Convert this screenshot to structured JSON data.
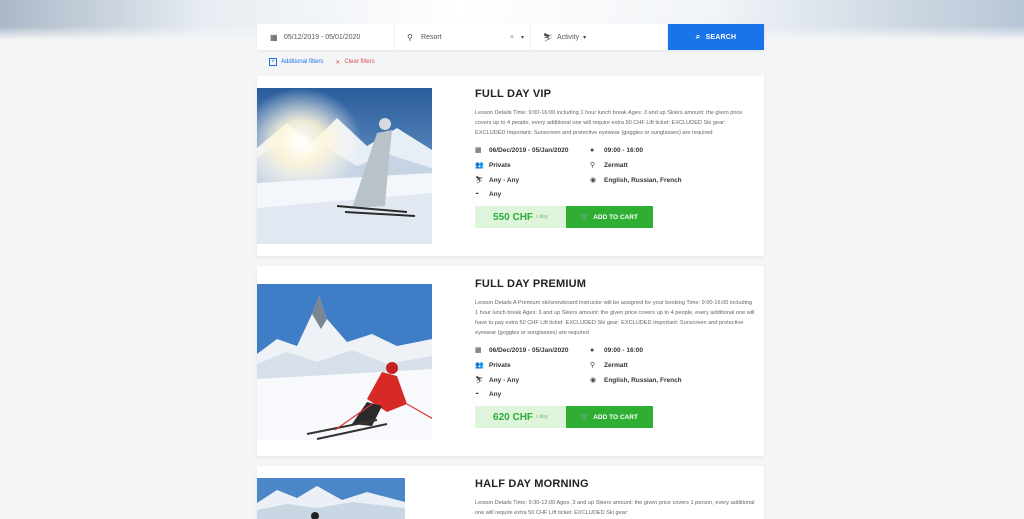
{
  "search": {
    "date_range": "05/12/2019 - 05/01/2020",
    "resort_placeholder": "Resort",
    "resort_clear": "×",
    "activity_label": "Activity",
    "search_label": "SEARCH",
    "icons": {
      "date": "calendar-icon",
      "resort": "map-pin-icon",
      "activity": "skier-icon",
      "search": "search-icon"
    }
  },
  "filters": {
    "additional_label": "Additional filters",
    "clear_label": "Clear filters"
  },
  "lessons": [
    {
      "title": "FULL DAY VIP",
      "description": "Lesson Details Time: 9:00-16:00 including 1 hour lunch break Ages: 3 and up Skiers amount: the given price covers up to 4 people, every additional one will require extra 50 CHF Lift ticket: EXCLUDED Ski gear: EXCLUDED Important: Sunscreen and protective eyewear (goggles or sunglasses) are required",
      "dates": "06/Dec/2019 - 05/Jan/2020",
      "time": "09:00 - 16:00",
      "type": "Private",
      "location": "Zermatt",
      "ages": "Any - Any",
      "languages": "English, Russian, French",
      "level": "Any",
      "price": "550 CHF",
      "price_unit": "/ day",
      "cart_label": "ADD TO CART"
    },
    {
      "title": "FULL DAY PREMIUM",
      "description": "Lesson Details A Premium ski/snowboard instructor will be assigned for your booking Time: 9:00-16:00 including 1 hour lunch break Ages: 3 and up Skiers amount: the given price covers up to 4 people, every additional one will have to pay extra 50 CHF Lift ticket: EXCLUDED Ski gear: EXCLUDED Important: Sunscreen and protective eyewear (goggles or sunglasses) are required",
      "dates": "06/Dec/2019 - 05/Jan/2020",
      "time": "09:00 - 16:00",
      "type": "Private",
      "location": "Zermatt",
      "ages": "Any - Any",
      "languages": "English, Russian, French",
      "level": "Any",
      "price": "620 CHF",
      "price_unit": "/ day",
      "cart_label": "ADD TO CART"
    },
    {
      "title": "HALF DAY MORNING",
      "description": "Lesson Details Time: 9:30-12:00 Ages: 3 and up Skiers amount: the given price covers 1 person, every additional one will require extra 50 CHF Lift ticket: EXCLUDED Ski gear:"
    }
  ],
  "colors": {
    "primary": "#1a73e8",
    "success": "#2fae33",
    "price_bg": "#def5dc",
    "danger": "#d9534f"
  }
}
